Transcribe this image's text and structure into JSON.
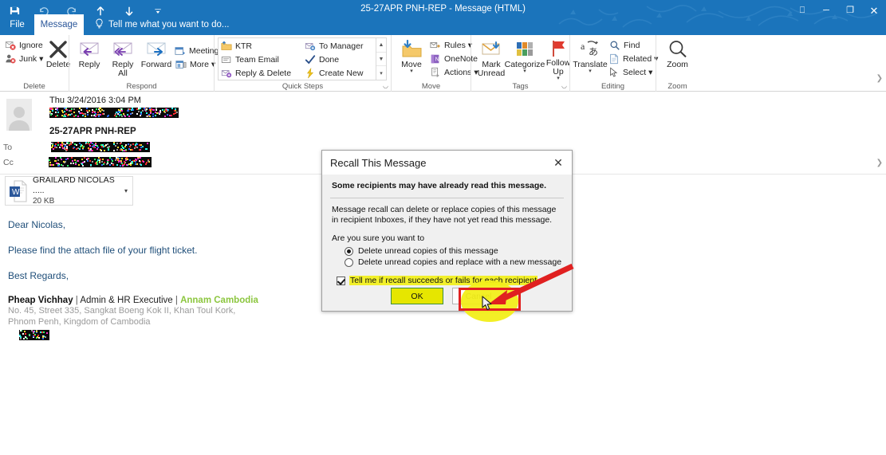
{
  "window": {
    "title": "25-27APR PNH-REP - Message (HTML)",
    "quick_access": [
      {
        "name": "save-icon",
        "glyph": "save"
      },
      {
        "name": "undo-icon",
        "glyph": "undo"
      },
      {
        "name": "redo-icon",
        "glyph": "redo"
      },
      {
        "name": "previous-item-icon",
        "glyph": "up"
      },
      {
        "name": "next-item-icon",
        "glyph": "down"
      },
      {
        "name": "customize-quick-access-toolbar-icon",
        "glyph": "caret"
      }
    ],
    "controls": {
      "ribbon_display_options": "⎕",
      "minimize": "─",
      "restore": "❐",
      "close": "✕"
    }
  },
  "tabs": {
    "file": "File",
    "message": "Message",
    "tell_me": "Tell me what you want to do..."
  },
  "ribbon": {
    "groups": [
      {
        "label": "Delete",
        "small_items": [
          {
            "label": "Ignore",
            "icon": "ignore-icon"
          },
          {
            "label": "Junk ▾",
            "icon": "junk-icon"
          }
        ],
        "big_items": [
          {
            "label": "Delete",
            "icon": "delete-x-icon"
          }
        ]
      },
      {
        "label": "Respond",
        "big_items": [
          {
            "label": "Reply",
            "icon": "reply-icon"
          },
          {
            "label": "Reply All",
            "icon": "reply-all-icon"
          },
          {
            "label": "Forward",
            "icon": "forward-icon"
          }
        ],
        "small_items": [
          {
            "label": "Meeting",
            "icon": "meeting-icon"
          },
          {
            "label": "More ▾",
            "icon": "more-icon"
          }
        ]
      },
      {
        "label": "Quick Steps",
        "has_dialog_launcher": true,
        "gallery": [
          {
            "label": "KTR",
            "icon": "folder-move-icon"
          },
          {
            "label": "Team Email",
            "icon": "team-email-icon"
          },
          {
            "label": "Reply & Delete",
            "icon": "reply-delete-icon"
          },
          {
            "label": "To Manager",
            "icon": "to-manager-icon"
          },
          {
            "label": "Done",
            "icon": "done-check-icon"
          },
          {
            "label": "Create New",
            "icon": "create-new-icon"
          }
        ]
      },
      {
        "label": "Move",
        "big_items": [
          {
            "label": "Move",
            "icon": "move-folder-icon",
            "caret": true
          }
        ],
        "small_items": [
          {
            "label": "Rules ▾",
            "icon": "rules-icon"
          },
          {
            "label": "OneNote",
            "icon": "onenote-icon"
          },
          {
            "label": "Actions ▾",
            "icon": "actions-icon"
          }
        ]
      },
      {
        "label": "Tags",
        "has_dialog_launcher": true,
        "big_items": [
          {
            "label": "Mark Unread",
            "icon": "mark-unread-icon"
          },
          {
            "label": "Categorize",
            "icon": "categorize-icon",
            "caret": true
          },
          {
            "label": "Follow Up",
            "icon": "follow-up-flag-icon",
            "caret": true
          }
        ]
      },
      {
        "label": "Editing",
        "big_items": [
          {
            "label": "Translate",
            "icon": "translate-icon",
            "caret": true
          }
        ],
        "small_items": [
          {
            "label": "Find",
            "icon": "find-icon"
          },
          {
            "label": "Related ▾",
            "icon": "related-icon"
          },
          {
            "label": "Select ▾",
            "icon": "select-icon"
          }
        ]
      },
      {
        "label": "Zoom",
        "big_items": [
          {
            "label": "Zoom",
            "icon": "zoom-magnifier-icon"
          }
        ]
      }
    ]
  },
  "message": {
    "date": "Thu 3/24/2016 3:04 PM",
    "from_redacted": true,
    "subject": "25-27APR PNH-REP",
    "to_label": "To",
    "cc_label": "Cc",
    "to_redacted": true,
    "cc_redacted": true,
    "attachment": {
      "name": "GRAILARD NICOLAS .....",
      "size": "20 KB",
      "icon": "word-document-icon"
    },
    "body": {
      "greeting": "Dear Nicolas,",
      "line1": "Please find the attach file of your flight ticket.",
      "closing": "Best Regards,",
      "signature": {
        "name": "Pheap Vichhay",
        "sep1": " | ",
        "role": "Admin & HR Executive",
        "sep2": " | ",
        "company": "Annam Cambodia",
        "address1": "No. 45, Street 335, Sangkat Boeng Kok II, Khan Toul Kork,",
        "address2": "Phnom Penh, Kingdom of Cambodia"
      }
    }
  },
  "dialog": {
    "title": "Recall This Message",
    "close_icon": "✕",
    "warning": "Some recipients may have already read this message.",
    "description": "Message recall can delete or replace copies of this message in recipient Inboxes, if they have not yet read this message.",
    "question": "Are you sure you want to",
    "options": [
      {
        "label": "Delete unread copies of this message",
        "selected": true
      },
      {
        "label": "Delete unread copies and replace with a new message",
        "selected": false
      }
    ],
    "checkbox": {
      "label": "Tell me if recall succeeds or fails for each recipient",
      "checked": true
    },
    "ok_label": "OK",
    "cancel_label": "Cancel"
  },
  "colors": {
    "accent": "#1b74bb",
    "brand_green": "#8cc63f",
    "body_text": "#1f4e79",
    "highlight": "#f2ee1a",
    "annotation_red": "#e02020"
  }
}
